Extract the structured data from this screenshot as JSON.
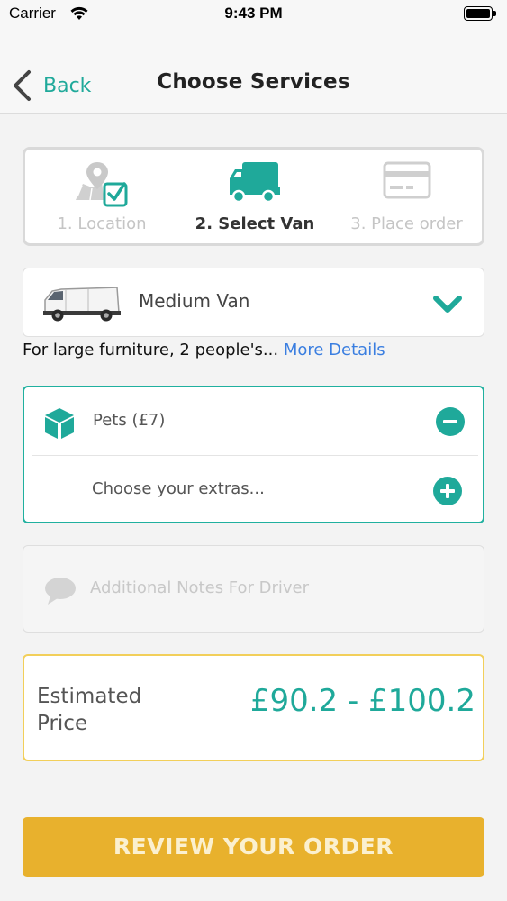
{
  "status_bar": {
    "carrier": "Carrier",
    "time": "9:43 PM"
  },
  "nav": {
    "back_label": "Back",
    "title": "Choose Services"
  },
  "stepper": {
    "steps": [
      {
        "label": "1. Location",
        "icon": "map-check-icon",
        "state": "inactive"
      },
      {
        "label": "2. Select Van",
        "icon": "truck-icon",
        "state": "active"
      },
      {
        "label": "3. Place order",
        "icon": "credit-card-icon",
        "state": "inactive"
      }
    ]
  },
  "van": {
    "selected": "Medium Van",
    "description": "For large furniture, 2 people's...",
    "more_link": "More Details"
  },
  "extras": {
    "items": [
      {
        "label": "Pets (£7)",
        "action": "remove"
      }
    ],
    "add_placeholder": "Choose your extras..."
  },
  "notes": {
    "placeholder": "Additional Notes For Driver"
  },
  "price": {
    "label": "Estimated Price",
    "value": "£90.2 - £100.2"
  },
  "cta": {
    "label": "REVIEW YOUR ORDER"
  },
  "colors": {
    "accent": "#1fa99a",
    "link": "#3a7ee0",
    "cta": "#e8b12d",
    "price_border": "#f2cf5a"
  }
}
